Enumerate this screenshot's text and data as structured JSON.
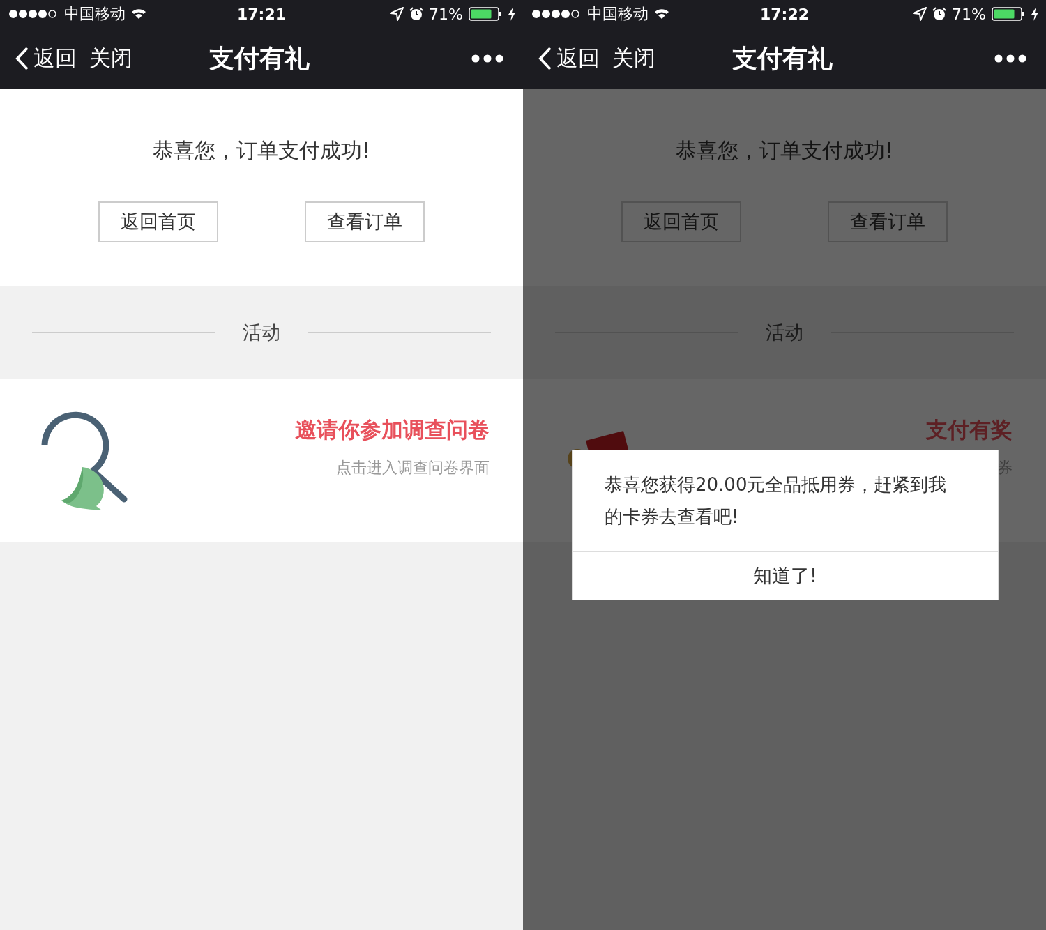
{
  "screens": [
    {
      "status_bar": {
        "carrier": "中国移动",
        "time": "17:21",
        "battery": "71%"
      },
      "nav": {
        "back": "返回",
        "close": "关闭",
        "title": "支付有礼"
      },
      "message": "恭喜您，订单支付成功!",
      "buttons": [
        "返回首页",
        "查看订单"
      ],
      "section_title": "活动",
      "activity": {
        "kind": "survey",
        "title": "邀请你参加调查问卷",
        "subtitle": "点击进入调查问卷界面"
      }
    },
    {
      "status_bar": {
        "carrier": "中国移动",
        "time": "17:22",
        "battery": "71%"
      },
      "nav": {
        "back": "返回",
        "close": "关闭",
        "title": "支付有礼"
      },
      "message": "恭喜您，订单支付成功!",
      "buttons": [
        "返回首页",
        "查看订单"
      ],
      "section_title": "活动",
      "activity": {
        "kind": "coupon",
        "title": "支付有奖",
        "subtitle": "券"
      },
      "dialog": {
        "message": "恭喜您获得20.00元全品抵用券，赶紧到我的卡券去查看吧!",
        "button": "知道了!"
      }
    }
  ]
}
